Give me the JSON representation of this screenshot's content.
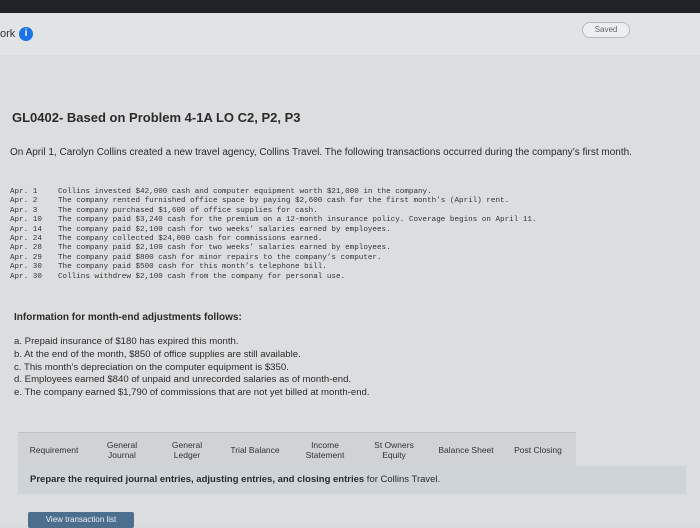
{
  "header": {
    "left_label": "ork",
    "info_icon": "info-icon",
    "saved": "Saved"
  },
  "problem": {
    "title": "GL0402- Based on Problem 4-1A LO C2, P2, P3",
    "intro": "On April 1, Carolyn Collins created a new travel agency, Collins Travel. The following transactions occurred during the company’s first month."
  },
  "transactions": [
    {
      "date": "Apr.  1",
      "text": "Collins invested $42,000 cash and computer equipment worth $21,000 in the company."
    },
    {
      "date": "Apr.  2",
      "text": "The company rented furnished office space by paying $2,600 cash for the first month’s (April) rent."
    },
    {
      "date": "Apr.  3",
      "text": "The company purchased $1,600 of office supplies for cash."
    },
    {
      "date": "Apr. 10",
      "text": "The company paid $3,240 cash for the premium on a 12-month insurance policy. Coverage begins on April 11."
    },
    {
      "date": "Apr. 14",
      "text": "The company paid $2,100 cash for two weeks’ salaries earned by employees."
    },
    {
      "date": "Apr. 24",
      "text": "The company collected $24,000 cash for commissions earned."
    },
    {
      "date": "Apr. 28",
      "text": "The company paid $2,100 cash for two weeks’ salaries earned by employees."
    },
    {
      "date": "Apr. 29",
      "text": "The company paid $800 cash for minor repairs to the company’s computer."
    },
    {
      "date": "Apr. 30",
      "text": "The company paid $500 cash for this month’s telephone bill."
    },
    {
      "date": "Apr. 30",
      "text": "Collins withdrew $2,100 cash from the company for personal use."
    }
  ],
  "adjustments": {
    "heading": "Information for month-end adjustments follows:",
    "items": [
      "a. Prepaid insurance of $180 has expired this month.",
      "b. At the end of the month, $850 of office supplies are still available.",
      "c. This month’s depreciation on the computer equipment is $350.",
      "d. Employees earned $840 of unpaid and unrecorded salaries as of month-end.",
      "e. The company earned $1,790 of commissions that are not yet billed at month-end."
    ]
  },
  "tabs": [
    {
      "label": "Requirement"
    },
    {
      "label": "General Journal"
    },
    {
      "label": "General Ledger"
    },
    {
      "label": "Trial Balance"
    },
    {
      "label": "Income Statement"
    },
    {
      "label": "St Owners Equity"
    },
    {
      "label": "Balance Sheet"
    },
    {
      "label": "Post Closing"
    }
  ],
  "panel": {
    "bold": "Prepare the required journal entries, adjusting entries, and closing entries",
    "rest": " for Collins Travel."
  },
  "button": {
    "view_transaction_list": "View transaction list"
  }
}
